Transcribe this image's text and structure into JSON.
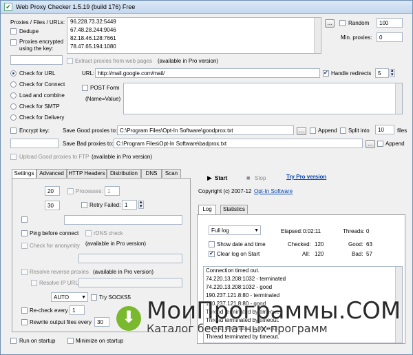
{
  "window": {
    "title": "Web Proxy Checker 1.5.19 (build 176) Free"
  },
  "proxies": {
    "label": "Proxies / Files / URLs:",
    "list": [
      "96.228.73.32:5449",
      "67.48.28.244:9046",
      "82.18.46.128:7661",
      "78.47.65.194:1080"
    ],
    "dedupe": "Dedupe",
    "encrypted": "Proxies encrypted using the key:",
    "extract": "Extract proxies from web pages",
    "pro_note": "(available in Pro version)",
    "browse": "...",
    "random_label": "Random",
    "random_value": "100",
    "minproxies_label": "Min. proxies:",
    "minproxies_value": "0"
  },
  "mode": {
    "check_url": "Check for URL",
    "check_connect": "Check for Connect",
    "load_combine": "Load and combine",
    "check_smtp": "Check for SMTP",
    "check_delivery": "Check for Delivery"
  },
  "url": {
    "label": "URL:",
    "value": "http://mail.google.com/mail/",
    "handle_redirects": "Handle redirects",
    "redirects_value": "5",
    "post_form": "POST Form",
    "name_value": "(Name=Value)"
  },
  "save": {
    "encrypt_key": "Encrypt key:",
    "good_label": "Save Good proxies to:",
    "good_path": "C:\\Program Files\\Opt-In Software\\goodprox.txt",
    "bad_label": "Save Bad proxies to:",
    "bad_path": "C:\\Program Files\\Opt-In Software\\badprox.txt",
    "append": "Append",
    "split_into": "Split into",
    "split_value": "10",
    "files": "files",
    "upload_ftp": "Upload Good proxies to FTP",
    "pro_note": "(available in Pro version)",
    "browse": "..."
  },
  "tabs": [
    "Settings",
    "Advanced",
    "HTTP Headers",
    "Distribution",
    "DNS",
    "Scan"
  ],
  "settings": {
    "val1": "20",
    "processes": "Processes:",
    "processes_value": "1",
    "val2": "30",
    "retry_failed": "Retry Failed:",
    "retry_value": "1",
    "ping": "Ping before connect",
    "rdns": "rDNS check",
    "check_anon": "Check for anonymity",
    "pro_note1": "(available in Pro version)",
    "resolve_reverse": "Resolve reverse proxies",
    "pro_note2": "(available in Pro version)",
    "resolve_ip": "Resolve IP URL:",
    "proto": "AUTO",
    "try_socks": "Try SOCKS5",
    "recheck": "Re-check every",
    "recheck_value": "1",
    "rewrite": "Rewrite output files every",
    "rewrite_value": "30"
  },
  "bottom": {
    "run_startup": "Run on startup",
    "minimize_startup": "Minimize on startup"
  },
  "controls": {
    "start": "Start",
    "stop": "Stop",
    "try_pro": "Try Pro version",
    "copyright": "Copyright (c) 2007-12",
    "company": "Opt-In Software"
  },
  "log": {
    "tabs": [
      "Log",
      "Statistics"
    ],
    "mode": "Full log",
    "elapsed_label": "Elapsed:",
    "elapsed": "0:02:11",
    "threads_label": "Threads:",
    "threads": "0",
    "show_datetime": "Show date and time",
    "clear_log": "Clear log on Start",
    "checked_label": "Checked:",
    "checked": "120",
    "good_label": "Good:",
    "good": "63",
    "all_label": "All:",
    "all": "120",
    "bad_label": "Bad:",
    "bad": "57",
    "lines": [
      "Connection timed out.",
      "74.220.13.208:1032 - terminated",
      "74.220.13.208:1032 - good",
      "190.237.121.8:80 - terminated",
      "190.237.121.8:80 - good",
      "Thread terminated by timeout.",
      "Thread terminated by timeout.",
      "Thread terminated by timeout.",
      "Thread terminated by timeout."
    ]
  },
  "watermark": {
    "line1": "МоиПрограммы.COM",
    "line2": "Каталог бесплатных программ"
  }
}
